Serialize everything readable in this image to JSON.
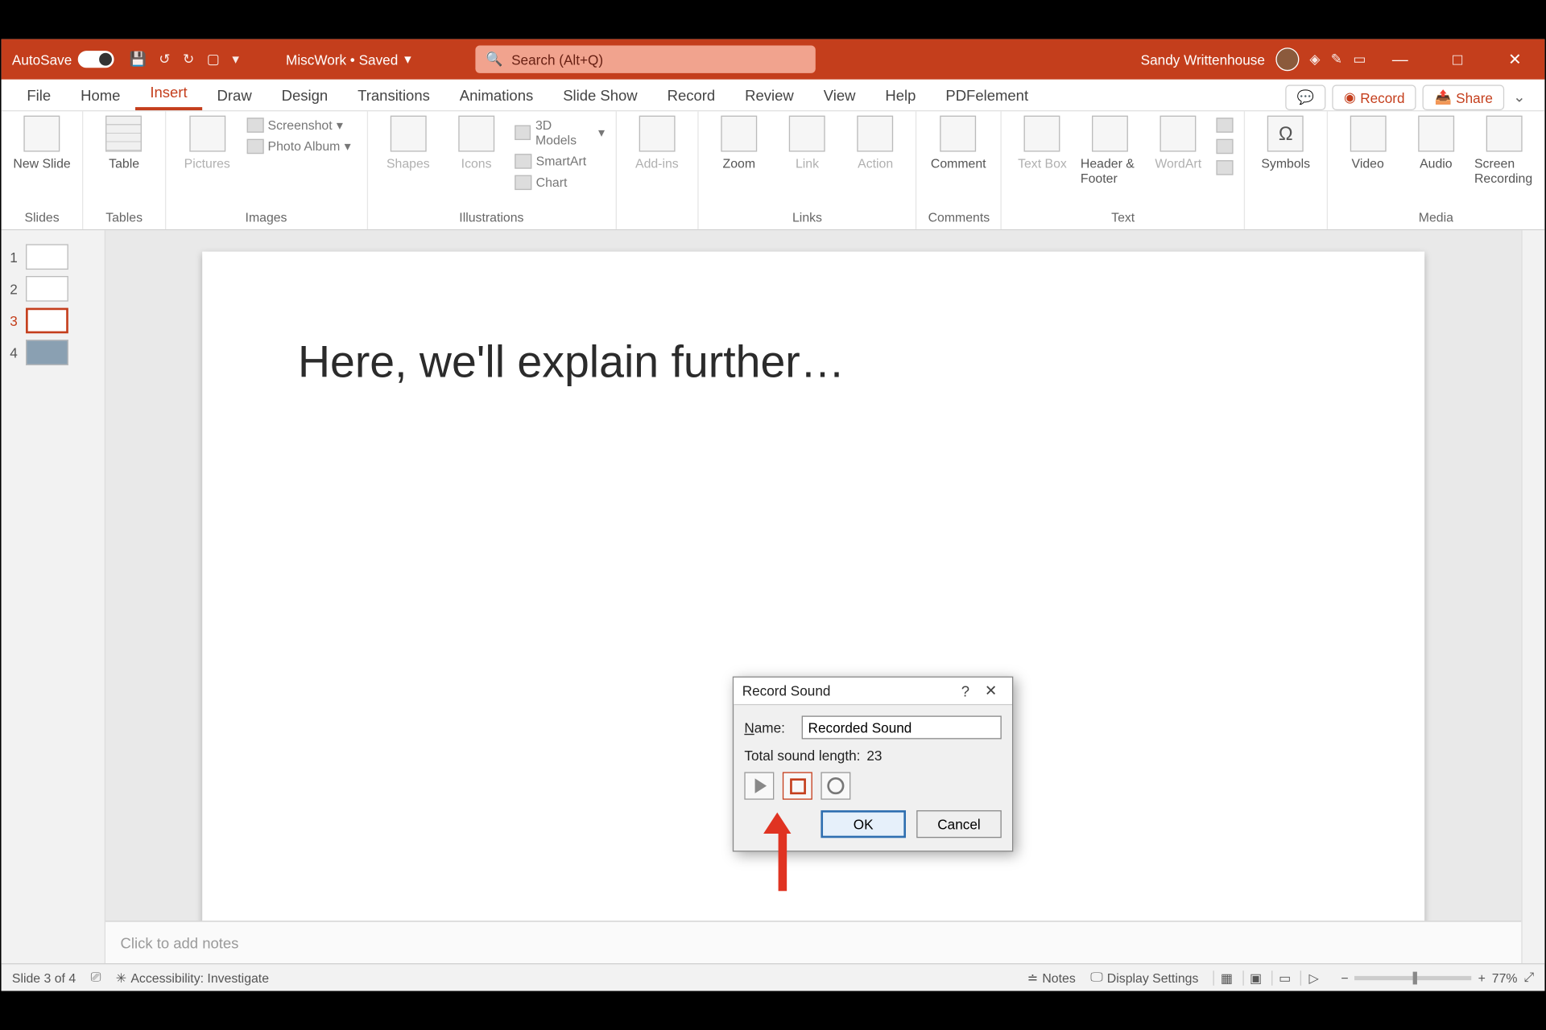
{
  "titlebar": {
    "autosave_label": "AutoSave",
    "autosave_state": "On",
    "doc_name": "MiscWork • Saved",
    "search_placeholder": "Search (Alt+Q)",
    "user_name": "Sandy Writtenhouse"
  },
  "tabs": {
    "items": [
      "File",
      "Home",
      "Insert",
      "Draw",
      "Design",
      "Transitions",
      "Animations",
      "Slide Show",
      "Record",
      "Review",
      "View",
      "Help",
      "PDFelement"
    ],
    "active_index": 2,
    "record_label": "Record",
    "share_label": "Share"
  },
  "ribbon": {
    "slides": {
      "new_slide": "New Slide",
      "label": "Slides"
    },
    "tables": {
      "table": "Table",
      "label": "Tables"
    },
    "images": {
      "pictures": "Pictures",
      "screenshot": "Screenshot",
      "photo_album": "Photo Album",
      "label": "Images"
    },
    "illustrations": {
      "shapes": "Shapes",
      "icons": "Icons",
      "models": "3D Models",
      "smartart": "SmartArt",
      "chart": "Chart",
      "label": "Illustrations"
    },
    "addins": {
      "addins": "Add-ins",
      "label": ""
    },
    "links": {
      "zoom": "Zoom",
      "link": "Link",
      "action": "Action",
      "label": "Links"
    },
    "comments": {
      "comment": "Comment",
      "label": "Comments"
    },
    "text": {
      "textbox": "Text Box",
      "header": "Header & Footer",
      "wordart": "WordArt",
      "label": "Text"
    },
    "symbols": {
      "symbols": "Symbols",
      "label": ""
    },
    "media": {
      "video": "Video",
      "audio": "Audio",
      "screenrec": "Screen Recording",
      "label": "Media"
    }
  },
  "thumbnails": {
    "items": [
      "1",
      "2",
      "3",
      "4"
    ],
    "selected": 3
  },
  "slide": {
    "title": "Here, we'll explain further…"
  },
  "dialog": {
    "title": "Record Sound",
    "name_label": "Name:",
    "name_value": "Recorded Sound",
    "length_label": "Total sound length:",
    "length_value": "23",
    "ok": "OK",
    "cancel": "Cancel"
  },
  "notes": {
    "placeholder": "Click to add notes"
  },
  "status": {
    "slide_info": "Slide 3 of 4",
    "accessibility": "Accessibility: Investigate",
    "notes": "Notes",
    "display": "Display Settings",
    "zoom": "77%"
  }
}
